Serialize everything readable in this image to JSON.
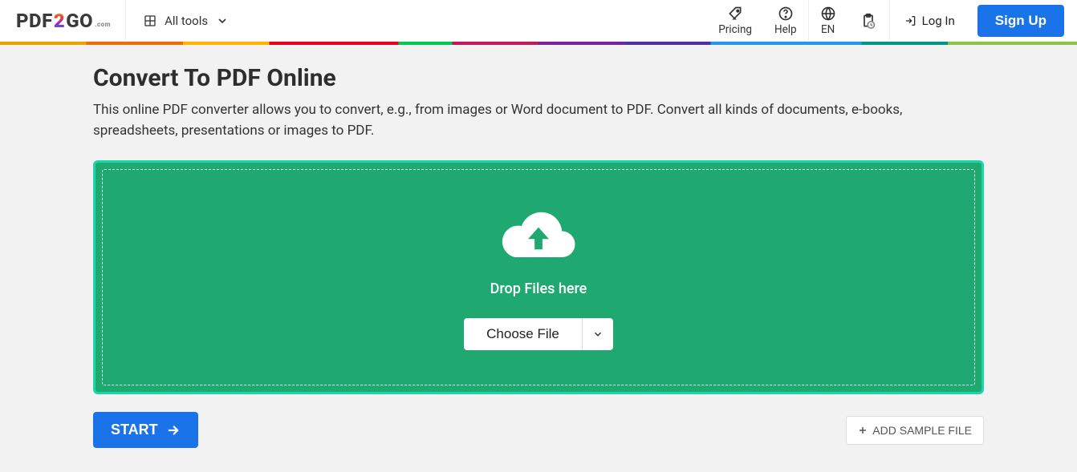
{
  "header": {
    "logo_pdf": "PDF",
    "logo_2": "2",
    "logo_go": "GO",
    "logo_com": ".com",
    "all_tools": "All tools",
    "pricing": "Pricing",
    "help": "Help",
    "lang": "EN",
    "login": "Log In",
    "signup": "Sign Up"
  },
  "main": {
    "title": "Convert To PDF Online",
    "subtitle": "This online PDF converter allows you to convert, e.g., from images or Word document to PDF. Convert all kinds of documents, e-books, spreadsheets, presentations or images to PDF.",
    "drop_label": "Drop Files here",
    "choose_file": "Choose File",
    "start": "START",
    "add_sample": "ADD SAMPLE FILE"
  }
}
